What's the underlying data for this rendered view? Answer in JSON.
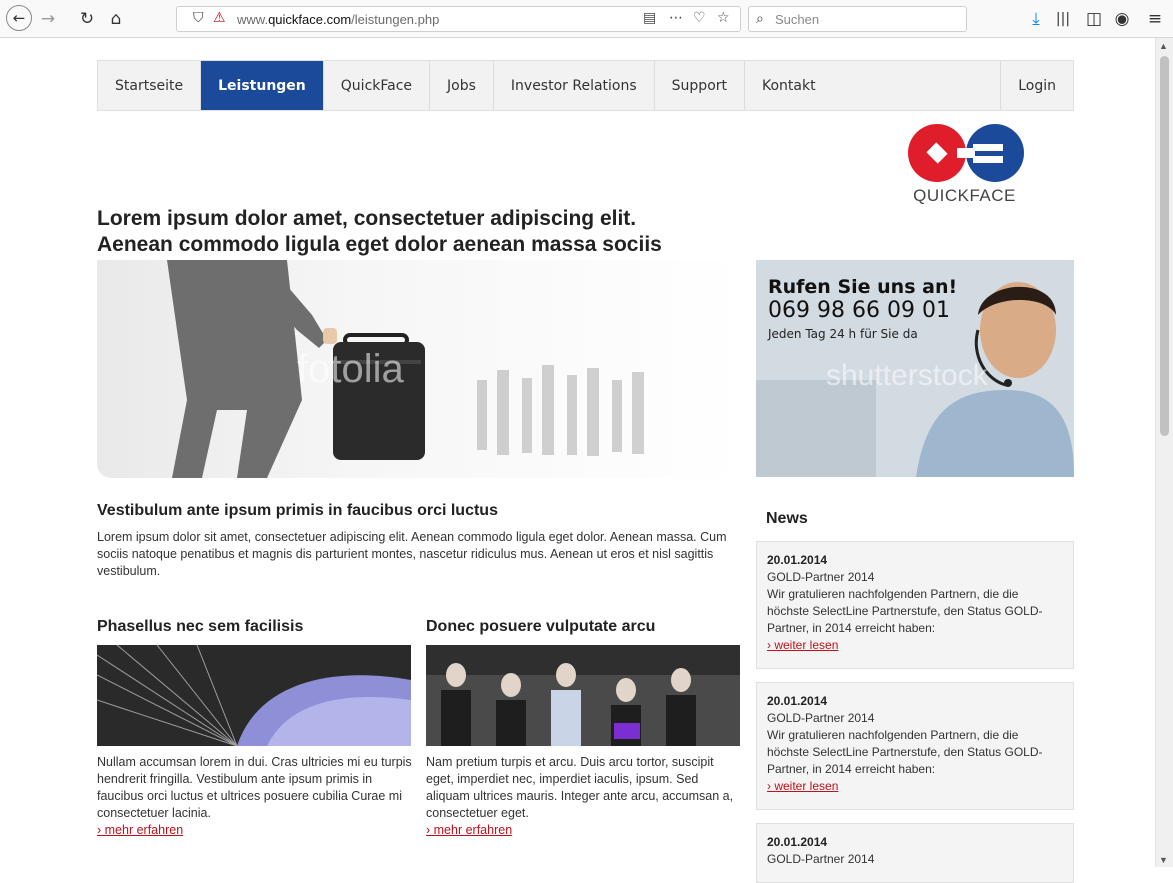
{
  "browser": {
    "url_prefix": "www.",
    "url_domain": "quickface.com",
    "url_path": "/leistungen.php",
    "search_placeholder": "Suchen"
  },
  "nav": {
    "items": [
      {
        "label": "Startseite"
      },
      {
        "label": "Leistungen"
      },
      {
        "label": "QuickFace"
      },
      {
        "label": "Jobs"
      },
      {
        "label": "Investor Relations"
      },
      {
        "label": "Support"
      },
      {
        "label": "Kontakt"
      }
    ],
    "login": "Login"
  },
  "logo": {
    "text": "QUICKFACE"
  },
  "headline": {
    "line1": "Lorem ipsum dolor amet, consectetuer adipiscing elit.",
    "line2": "Aenean commodo ligula eget dolor aenean massa sociis"
  },
  "hero": {
    "watermark": "fotolia"
  },
  "call": {
    "title": "Rufen Sie uns an!",
    "phone": "069 98 66 09 01",
    "sub": "Jeden Tag 24 h für Sie da",
    "watermark": "shutterstock"
  },
  "intro": {
    "title": "Vestibulum ante ipsum primis in faucibus orci luctus",
    "text": "Lorem ipsum dolor sit amet, consectetuer adipiscing elit. Aenean commodo ligula eget dolor. Aenean massa. Cum sociis natoque penatibus et magnis dis parturient montes, nascetur ridiculus mus. Aenean ut eros et nisl sagittis vestibulum."
  },
  "teasers": [
    {
      "title": "Phasellus nec sem facilisis",
      "text": "Nullam accumsan lorem in dui. Cras ultricies mi eu turpis hendrerit fringilla. Vestibulum ante ipsum primis in faucibus orci luctus et ultrices posuere cubilia Curae mi consectetuer lacinia.",
      "link": "› mehr erfahren"
    },
    {
      "title": "Donec posuere vulputate arcu",
      "text": "Nam pretium turpis et arcu. Duis arcu tortor, suscipit eget, imperdiet nec, imperdiet iaculis, ipsum. Sed aliquam ultrices mauris. Integer ante arcu, accumsan a, consectetuer eget.",
      "link": "› mehr erfahren"
    }
  ],
  "news": {
    "title": "News",
    "items": [
      {
        "date": "20.01.2014",
        "headline": "GOLD-Partner 2014",
        "text": "Wir gratulieren nachfolgenden Partnern, die die höchste SelectLine Partnerstufe, den Status GOLD-Partner, in 2014 erreicht haben:",
        "link": "› weiter lesen"
      },
      {
        "date": "20.01.2014",
        "headline": "GOLD-Partner 2014",
        "text": "Wir gratulieren nachfolgenden Partnern, die die höchste SelectLine Partnerstufe, den Status GOLD-Partner, in 2014 erreicht haben:",
        "link": "› weiter lesen"
      },
      {
        "date": "20.01.2014",
        "headline": "GOLD-Partner 2014"
      }
    ]
  },
  "colors": {
    "nav_active": "#1c4a9b",
    "logo_red": "#e01e2b",
    "logo_blue": "#1c4a9b",
    "link_red": "#c0101b"
  }
}
